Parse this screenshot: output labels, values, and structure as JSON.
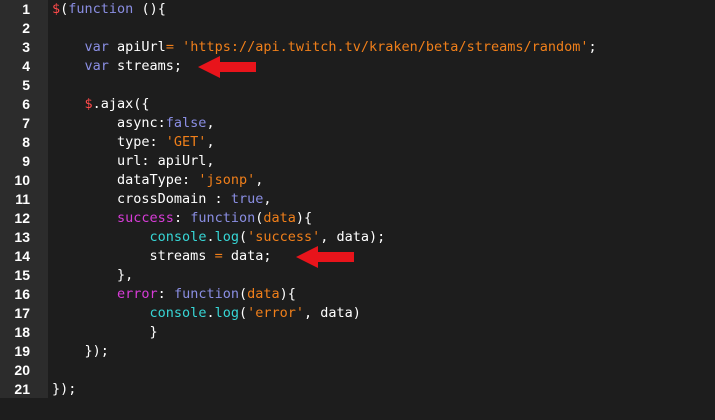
{
  "editor": {
    "background": "#1d1d1d",
    "gutter_background": "#2c2c2c",
    "colors": {
      "plain": "#ffffff",
      "keyword": "#8a8ee3",
      "string": "#f07f1a",
      "dollar": "#ff4a4a",
      "property": "#d83cd8",
      "method": "#37d6d6",
      "annotation_arrow": "#e8141b"
    },
    "lines": [
      {
        "number": "1",
        "tokens": [
          {
            "t": "$",
            "c": "dollar"
          },
          {
            "t": "(",
            "c": "plain"
          },
          {
            "t": "function",
            "c": "keyword"
          },
          {
            "t": " (){",
            "c": "plain"
          }
        ]
      },
      {
        "number": "2",
        "tokens": []
      },
      {
        "number": "3",
        "tokens": [
          {
            "t": "    ",
            "c": "plain"
          },
          {
            "t": "var",
            "c": "keyword"
          },
          {
            "t": " apiUrl",
            "c": "plain"
          },
          {
            "t": "=",
            "c": "operator"
          },
          {
            "t": " ",
            "c": "plain"
          },
          {
            "t": "'https://api.twitch.tv/kraken/beta/streams/random'",
            "c": "string"
          },
          {
            "t": ";",
            "c": "plain"
          }
        ]
      },
      {
        "number": "4",
        "tokens": [
          {
            "t": "    ",
            "c": "plain"
          },
          {
            "t": "var",
            "c": "keyword"
          },
          {
            "t": " streams;",
            "c": "plain"
          }
        ]
      },
      {
        "number": "5",
        "tokens": []
      },
      {
        "number": "6",
        "tokens": [
          {
            "t": "    ",
            "c": "plain"
          },
          {
            "t": "$",
            "c": "dollar"
          },
          {
            "t": ".ajax({",
            "c": "plain"
          }
        ]
      },
      {
        "number": "7",
        "tokens": [
          {
            "t": "        async:",
            "c": "plain"
          },
          {
            "t": "false",
            "c": "keyword"
          },
          {
            "t": ",",
            "c": "plain"
          }
        ]
      },
      {
        "number": "8",
        "tokens": [
          {
            "t": "        type: ",
            "c": "plain"
          },
          {
            "t": "'GET'",
            "c": "string"
          },
          {
            "t": ",",
            "c": "plain"
          }
        ]
      },
      {
        "number": "9",
        "tokens": [
          {
            "t": "        url: apiUrl,",
            "c": "plain"
          }
        ]
      },
      {
        "number": "10",
        "tokens": [
          {
            "t": "        dataType: ",
            "c": "plain"
          },
          {
            "t": "'jsonp'",
            "c": "string"
          },
          {
            "t": ",",
            "c": "plain"
          }
        ]
      },
      {
        "number": "11",
        "tokens": [
          {
            "t": "        crossDomain : ",
            "c": "plain"
          },
          {
            "t": "true",
            "c": "keyword"
          },
          {
            "t": ",",
            "c": "plain"
          }
        ]
      },
      {
        "number": "12",
        "tokens": [
          {
            "t": "        ",
            "c": "plain"
          },
          {
            "t": "success",
            "c": "prop"
          },
          {
            "t": ": ",
            "c": "plain"
          },
          {
            "t": "function",
            "c": "keyword"
          },
          {
            "t": "(",
            "c": "plain"
          },
          {
            "t": "data",
            "c": "string"
          },
          {
            "t": "){",
            "c": "plain"
          }
        ]
      },
      {
        "number": "13",
        "tokens": [
          {
            "t": "            ",
            "c": "plain"
          },
          {
            "t": "console",
            "c": "method"
          },
          {
            "t": ".",
            "c": "plain"
          },
          {
            "t": "log",
            "c": "method"
          },
          {
            "t": "(",
            "c": "plain"
          },
          {
            "t": "'success'",
            "c": "string"
          },
          {
            "t": ", data);",
            "c": "plain"
          }
        ]
      },
      {
        "number": "14",
        "tokens": [
          {
            "t": "            streams ",
            "c": "plain"
          },
          {
            "t": "=",
            "c": "operator"
          },
          {
            "t": " data;",
            "c": "plain"
          }
        ]
      },
      {
        "number": "15",
        "tokens": [
          {
            "t": "        },",
            "c": "plain"
          }
        ]
      },
      {
        "number": "16",
        "tokens": [
          {
            "t": "        ",
            "c": "plain"
          },
          {
            "t": "error",
            "c": "prop"
          },
          {
            "t": ": ",
            "c": "plain"
          },
          {
            "t": "function",
            "c": "keyword"
          },
          {
            "t": "(",
            "c": "plain"
          },
          {
            "t": "data",
            "c": "string"
          },
          {
            "t": "){",
            "c": "plain"
          }
        ]
      },
      {
        "number": "17",
        "tokens": [
          {
            "t": "            ",
            "c": "plain"
          },
          {
            "t": "console",
            "c": "method"
          },
          {
            "t": ".",
            "c": "plain"
          },
          {
            "t": "log",
            "c": "method"
          },
          {
            "t": "(",
            "c": "plain"
          },
          {
            "t": "'error'",
            "c": "string"
          },
          {
            "t": ", data)",
            "c": "plain"
          }
        ]
      },
      {
        "number": "18",
        "tokens": [
          {
            "t": "            }",
            "c": "plain"
          }
        ]
      },
      {
        "number": "19",
        "tokens": [
          {
            "t": "    });",
            "c": "plain"
          }
        ]
      },
      {
        "number": "20",
        "tokens": []
      },
      {
        "number": "21",
        "tokens": [
          {
            "t": "});",
            "c": "plain"
          }
        ]
      }
    ],
    "annotations": [
      {
        "name": "arrow-pointing-line-4",
        "points_to_line": "4"
      },
      {
        "name": "arrow-pointing-line-14",
        "points_to_line": "14"
      }
    ]
  }
}
